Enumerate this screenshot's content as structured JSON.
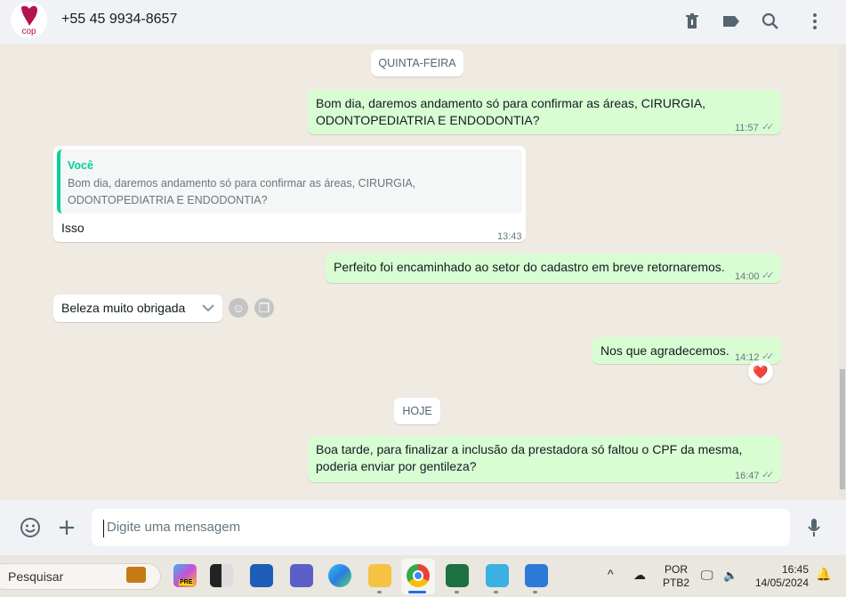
{
  "header": {
    "contact": "+55 45 9934-8657",
    "avatar_text": "cop",
    "icons": [
      "delete-icon",
      "label-icon",
      "search-icon",
      "menu-icon"
    ]
  },
  "chat": {
    "date_1": "QUINTA-FEIRA",
    "m1": {
      "line1": "Bom dia, daremos andamento só para confirmar as áreas, CIRURGIA,",
      "line2": "ODONTOPEDIATRIA E ENDODONTIA?",
      "time": "11:57"
    },
    "m2": {
      "quote_author": "Você",
      "quote_line1": "Bom dia, daremos andamento só para confirmar as áreas, CIRURGIA,",
      "quote_line2": "ODONTOPEDIATRIA E ENDODONTIA?",
      "text": "Isso",
      "time": "13:43"
    },
    "m3": {
      "text": "Perfeito foi encaminhado ao setor do cadastro em breve retornaremos.",
      "time": "14:00"
    },
    "m4": {
      "text": "Beleza muito obrigada"
    },
    "m5": {
      "text": "Nos que agradecemos.",
      "time": "14:12",
      "reaction": "❤️"
    },
    "date_2": "HOJE",
    "m6": {
      "line1": "Boa tarde, para finalizar a inclusão da prestadora só faltou o CPF da mesma,",
      "line2": "poderia enviar por gentileza?",
      "time": "16:47"
    }
  },
  "composer": {
    "placeholder": "Digite uma mensagem"
  },
  "taskbar": {
    "search": "Pesquisar",
    "lang1": "POR",
    "lang2": "PTB2",
    "time": "16:45",
    "date": "14/05/2024",
    "pre_badge": "PRE"
  },
  "colors": {
    "outgoing": "#d9fdd3",
    "accent": "#06cf9c",
    "chat_bg": "#efeae2"
  }
}
